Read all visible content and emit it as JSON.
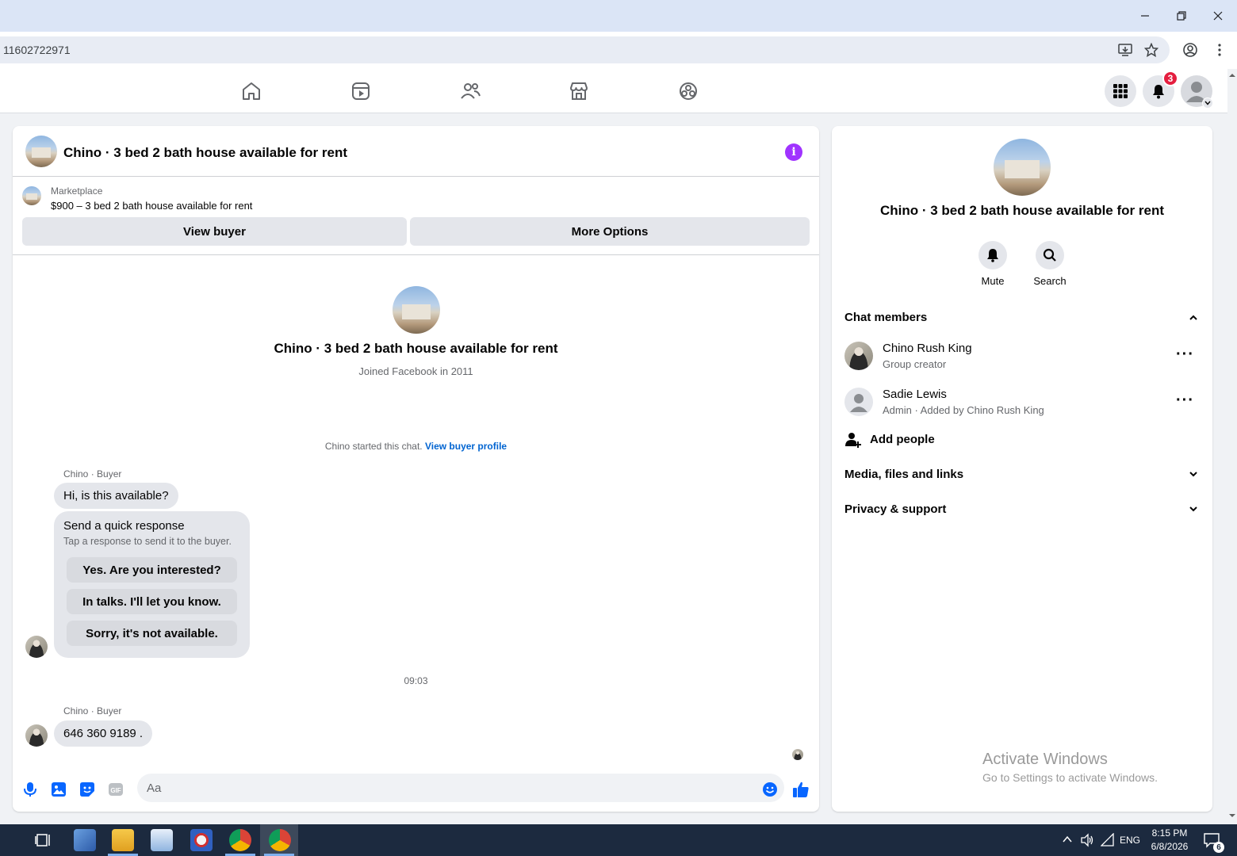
{
  "browser": {
    "address": "11602722971"
  },
  "nav": {
    "notification_count": "3"
  },
  "chat": {
    "header_title": "Chino · 3 bed 2 bath house available for rent",
    "listing_source": "Marketplace",
    "listing_desc": "$900 – 3 bed 2 bath house available for rent",
    "view_buyer_label": "View buyer",
    "more_options_label": "More Options",
    "intro_name": "Chino · 3 bed 2 bath house available for rent",
    "intro_joined": "Joined Facebook in 2011",
    "started_text": "Chino started this chat.",
    "started_link": "View buyer profile",
    "messages": [
      {
        "sender": "Chino · Buyer",
        "text": "Hi, is this available?"
      },
      {
        "sender": "Chino · Buyer",
        "text": "646 360 9189 ."
      }
    ],
    "quick_response": {
      "title": "Send a quick response",
      "subtitle": "Tap a response to send it to the buyer.",
      "options": [
        "Yes. Are you interested?",
        "In talks. I'll let you know.",
        "Sorry, it's not available."
      ]
    },
    "timestamp": "09:03",
    "composer_placeholder": "Aa"
  },
  "side": {
    "name": "Chino · 3 bed 2 bath house available for rent",
    "mute_label": "Mute",
    "search_label": "Search",
    "chat_members_label": "Chat members",
    "members": [
      {
        "name": "Chino Rush King",
        "role": "Group creator"
      },
      {
        "name": "Sadie Lewis",
        "role": "Admin · Added by Chino Rush King"
      }
    ],
    "add_people_label": "Add people",
    "media_label": "Media, files and links",
    "privacy_label": "Privacy & support",
    "watermark_title": "Activate Windows",
    "watermark_sub": "Go to Settings to activate Windows."
  },
  "taskbar": {
    "time": "8:15 PM",
    "date": "6/8/2026",
    "lang": "ENG",
    "notif_count": "6"
  },
  "colors": {
    "accent": "#0866ff",
    "info": "#a033ff",
    "badge": "#e41e3f"
  }
}
